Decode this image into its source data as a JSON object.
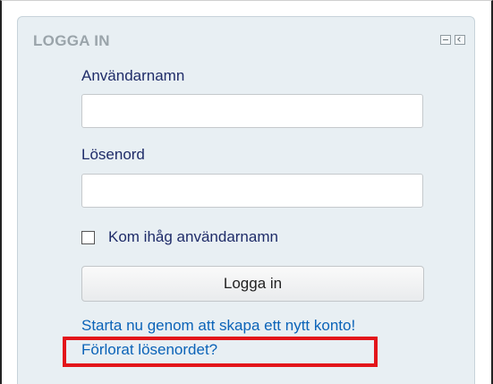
{
  "block": {
    "title": "LOGGA IN",
    "controls": [
      "minimize-icon",
      "dock-icon"
    ]
  },
  "form": {
    "username_label": "Användarnamn",
    "username_value": "",
    "password_label": "Lösenord",
    "password_value": "",
    "remember_label": "Kom ihåg användarnamn",
    "remember_checked": false,
    "login_button_label": "Logga in"
  },
  "links": {
    "signup": "Starta nu genom att skapa ett nytt konto!",
    "forgot_password": "Förlorat lösenordet?"
  },
  "colors": {
    "block_background": "#e8eff3",
    "label_text": "#1f2c69",
    "link_text": "#0b63b8",
    "highlight_border": "#e3151a"
  }
}
